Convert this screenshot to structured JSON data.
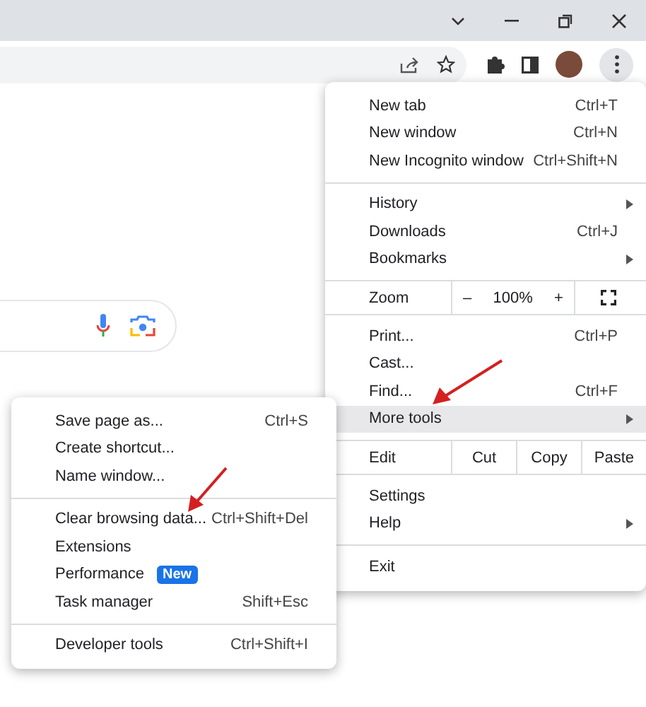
{
  "main_menu": [
    {
      "kind": "item",
      "label": "New tab",
      "shortcut": "Ctrl+T",
      "submenu": false,
      "selected": false
    },
    {
      "kind": "item",
      "label": "New window",
      "shortcut": "Ctrl+N",
      "submenu": false,
      "selected": false
    },
    {
      "kind": "item",
      "label": "New Incognito window",
      "shortcut": "Ctrl+Shift+N",
      "submenu": false,
      "selected": false
    },
    {
      "kind": "separator"
    },
    {
      "kind": "item",
      "label": "History",
      "submenu": true,
      "selected": false
    },
    {
      "kind": "item",
      "label": "Downloads",
      "shortcut": "Ctrl+J",
      "submenu": false,
      "selected": false
    },
    {
      "kind": "item",
      "label": "Bookmarks",
      "submenu": true,
      "selected": false
    },
    {
      "kind": "separator"
    },
    {
      "kind": "zoom",
      "label": "Zoom",
      "minus": "–",
      "value": "100%",
      "plus": "+"
    },
    {
      "kind": "separator"
    },
    {
      "kind": "item",
      "label": "Print...",
      "shortcut": "Ctrl+P",
      "submenu": false,
      "selected": false
    },
    {
      "kind": "item",
      "label": "Cast...",
      "submenu": false,
      "selected": false
    },
    {
      "kind": "item",
      "label": "Find...",
      "shortcut": "Ctrl+F",
      "submenu": false,
      "selected": false
    },
    {
      "kind": "item",
      "label": "More tools",
      "submenu": true,
      "selected": true
    },
    {
      "kind": "separator"
    },
    {
      "kind": "edit",
      "label": "Edit",
      "actions": [
        "Cut",
        "Copy",
        "Paste"
      ]
    },
    {
      "kind": "separator"
    },
    {
      "kind": "item",
      "label": "Settings",
      "submenu": false,
      "selected": false
    },
    {
      "kind": "item",
      "label": "Help",
      "submenu": true,
      "selected": false
    },
    {
      "kind": "separator"
    },
    {
      "kind": "item",
      "label": "Exit",
      "submenu": false,
      "selected": false
    }
  ],
  "more_tools_menu": [
    {
      "kind": "item",
      "label": "Save page as...",
      "shortcut": "Ctrl+S",
      "submenu": false,
      "selected": false
    },
    {
      "kind": "item",
      "label": "Create shortcut...",
      "submenu": false,
      "selected": false
    },
    {
      "kind": "item",
      "label": "Name window...",
      "submenu": false,
      "selected": false
    },
    {
      "kind": "separator"
    },
    {
      "kind": "item",
      "label": "Clear browsing data...",
      "shortcut": "Ctrl+Shift+Del",
      "submenu": false,
      "selected": false
    },
    {
      "kind": "item",
      "label": "Extensions",
      "submenu": false,
      "selected": false
    },
    {
      "kind": "item",
      "label": "Performance",
      "badge": "New",
      "submenu": false,
      "selected": false
    },
    {
      "kind": "item",
      "label": "Task manager",
      "shortcut": "Shift+Esc",
      "submenu": false,
      "selected": false
    },
    {
      "kind": "separator"
    },
    {
      "kind": "item",
      "label": "Developer tools",
      "shortcut": "Ctrl+Shift+I",
      "submenu": false,
      "selected": false
    }
  ]
}
